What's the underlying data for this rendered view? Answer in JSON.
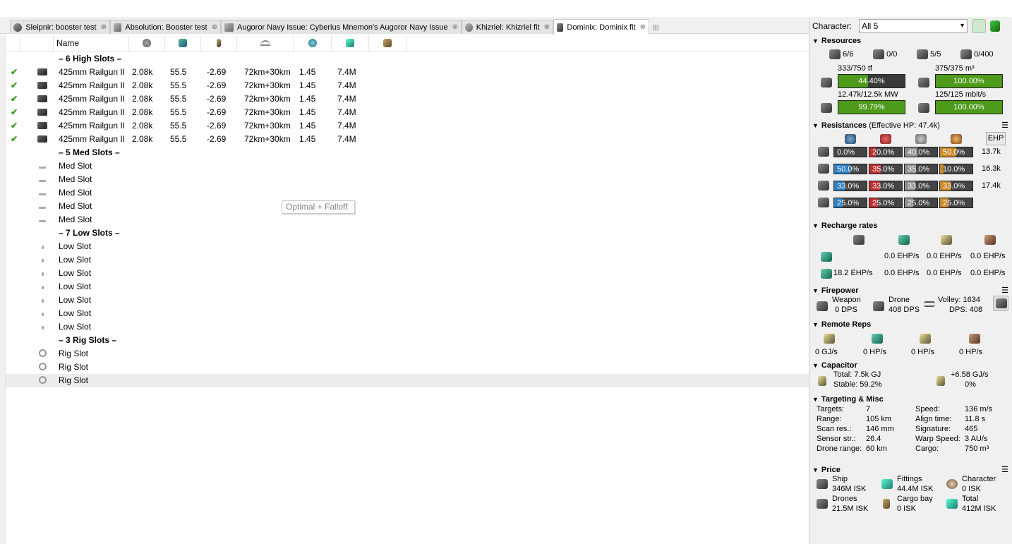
{
  "tabs": [
    {
      "label": "Sleipnir: booster test",
      "icon": "sleipnir-icon"
    },
    {
      "label": "Absolution: Booster test",
      "icon": "absolution-icon"
    },
    {
      "label": "Augoror Navy Issue: Cyberius Mnemon's Augoror Navy Issue",
      "icon": "augoror-icon"
    },
    {
      "label": "Khizriel: Khizriel fit",
      "icon": "khizriel-icon"
    },
    {
      "label": "Dominix: Dominix fit",
      "icon": "dominix-icon"
    }
  ],
  "table": {
    "name_header": "Name",
    "header_icons": [
      "capacitor-icon",
      "cpu-icon",
      "ammo-icon",
      "range-icon",
      "cycle-icon",
      "price-icon",
      "cargo-icon"
    ],
    "rows": [
      {
        "type": "header",
        "name": "– 6 High Slots –"
      },
      {
        "type": "module",
        "name": "425mm Railgun II",
        "c1": "2.08k",
        "c2": "55.5",
        "c3": "-2.69",
        "c4": "72km+30km",
        "c5": "1.45",
        "c6": "7.4M"
      },
      {
        "type": "module",
        "name": "425mm Railgun II",
        "c1": "2.08k",
        "c2": "55.5",
        "c3": "-2.69",
        "c4": "72km+30km",
        "c5": "1.45",
        "c6": "7.4M"
      },
      {
        "type": "module",
        "name": "425mm Railgun II",
        "c1": "2.08k",
        "c2": "55.5",
        "c3": "-2.69",
        "c4": "72km+30km",
        "c5": "1.45",
        "c6": "7.4M"
      },
      {
        "type": "module",
        "name": "425mm Railgun II",
        "c1": "2.08k",
        "c2": "55.5",
        "c3": "-2.69",
        "c4": "72km+30km",
        "c5": "1.45",
        "c6": "7.4M"
      },
      {
        "type": "module",
        "name": "425mm Railgun II",
        "c1": "2.08k",
        "c2": "55.5",
        "c3": "-2.69",
        "c4": "72km+30km",
        "c5": "1.45",
        "c6": "7.4M"
      },
      {
        "type": "module",
        "name": "425mm Railgun II",
        "c1": "2.08k",
        "c2": "55.5",
        "c3": "-2.69",
        "c4": "72km+30km",
        "c5": "1.45",
        "c6": "7.4M"
      },
      {
        "type": "header",
        "name": "– 5 Med Slots –"
      },
      {
        "type": "med",
        "name": "Med Slot"
      },
      {
        "type": "med",
        "name": "Med Slot"
      },
      {
        "type": "med",
        "name": "Med Slot"
      },
      {
        "type": "med",
        "name": "Med Slot"
      },
      {
        "type": "med",
        "name": "Med Slot"
      },
      {
        "type": "header",
        "name": "– 7 Low Slots –"
      },
      {
        "type": "low",
        "name": "Low Slot"
      },
      {
        "type": "low",
        "name": "Low Slot"
      },
      {
        "type": "low",
        "name": "Low Slot"
      },
      {
        "type": "low",
        "name": "Low Slot"
      },
      {
        "type": "low",
        "name": "Low Slot"
      },
      {
        "type": "low",
        "name": "Low Slot"
      },
      {
        "type": "low",
        "name": "Low Slot"
      },
      {
        "type": "header",
        "name": "– 3 Rig Slots –"
      },
      {
        "type": "rig",
        "name": "Rig Slot"
      },
      {
        "type": "rig",
        "name": "Rig Slot"
      },
      {
        "type": "rig",
        "name": "Rig Slot",
        "selected": true
      }
    ]
  },
  "tooltip": "Optimal + Falloff",
  "character": {
    "label": "Character:",
    "value": "All 5"
  },
  "resources": {
    "title": "Resources",
    "counts": [
      "6/6",
      "0/0",
      "5/5",
      "0/400"
    ],
    "cpu_label": "333/750 tf",
    "cpu_pct_label": "44.40%",
    "cpu_fraction": 0.444,
    "calib_label": "375/375 m³",
    "calib_pct_label": "100.00%",
    "calib_fraction": 1.0,
    "power_label": "12.47k/12.5k MW",
    "power_pct_label": "99.79%",
    "power_fraction": 0.9979,
    "bandwidth_label": "125/125 mbit/s",
    "bandwidth_pct_label": "100.00%",
    "bandwidth_fraction": 1.0
  },
  "resistances": {
    "title": "Resistances",
    "subtitle": "(Effective HP: 47.4k)",
    "ehp_button": "EHP",
    "rows": [
      {
        "values": [
          "0.0%",
          "20.0%",
          "40.0%",
          "50.0%"
        ],
        "fractions": [
          0.0,
          0.2,
          0.4,
          0.5
        ],
        "ehp": "13.7k"
      },
      {
        "values": [
          "50.0%",
          "35.0%",
          "35.0%",
          "10.0%"
        ],
        "fractions": [
          0.5,
          0.35,
          0.35,
          0.1
        ],
        "ehp": "16.3k"
      },
      {
        "values": [
          "33.0%",
          "33.0%",
          "33.0%",
          "33.0%"
        ],
        "fractions": [
          0.33,
          0.33,
          0.33,
          0.33
        ],
        "ehp": "17.4k"
      },
      {
        "values": [
          "25.0%",
          "25.0%",
          "25.0%",
          "25.0%"
        ],
        "fractions": [
          0.25,
          0.25,
          0.25,
          0.25
        ],
        "ehp": ""
      }
    ],
    "colors": [
      "#2f7fc0",
      "#c03030",
      "#909090",
      "#c88a2a"
    ]
  },
  "recharge": {
    "title": "Recharge rates",
    "row1": [
      "",
      "0.0 EHP/s",
      "0.0 EHP/s",
      "0.0 EHP/s"
    ],
    "row2": [
      "18.2 EHP/s",
      "0.0 EHP/s",
      "0.0 EHP/s",
      "0.0 EHP/s"
    ]
  },
  "firepower": {
    "title": "Firepower",
    "weapon_label": "Weapon",
    "weapon_dps": "0 DPS",
    "drone_label": "Drone",
    "drone_dps": "408 DPS",
    "volley": "Volley: 1634",
    "dps": "DPS: 408"
  },
  "remote_reps": {
    "title": "Remote Reps",
    "values": [
      "0 GJ/s",
      "0 HP/s",
      "0 HP/s",
      "0 HP/s"
    ]
  },
  "capacitor": {
    "title": "Capacitor",
    "total": "Total: 7.5k GJ",
    "stable": "Stable: 59.2%",
    "rate": "+6.58 GJ/s",
    "rate_pct": "0%"
  },
  "targeting": {
    "title": "Targeting & Misc",
    "left": [
      {
        "k": "Targets:",
        "v": "7"
      },
      {
        "k": "Range:",
        "v": "105 km"
      },
      {
        "k": "Scan res.:",
        "v": "146 mm"
      },
      {
        "k": "Sensor str.:",
        "v": "26.4"
      },
      {
        "k": "Drone range:",
        "v": "60 km"
      }
    ],
    "right": [
      {
        "k": "Speed:",
        "v": "136 m/s"
      },
      {
        "k": "Align time:",
        "v": "11.8 s"
      },
      {
        "k": "Signature:",
        "v": "465"
      },
      {
        "k": "Warp Speed:",
        "v": "3 AU/s"
      },
      {
        "k": "Cargo:",
        "v": "750 m³"
      }
    ]
  },
  "price": {
    "title": "Price",
    "items": [
      {
        "label": "Ship",
        "value": "346M ISK"
      },
      {
        "label": "Fittings",
        "value": "44.4M ISK"
      },
      {
        "label": "Character",
        "value": "0 ISK"
      },
      {
        "label": "Drones",
        "value": "21.5M ISK"
      },
      {
        "label": "Cargo bay",
        "value": "0 ISK"
      },
      {
        "label": "Total",
        "value": "412M ISK"
      }
    ]
  }
}
